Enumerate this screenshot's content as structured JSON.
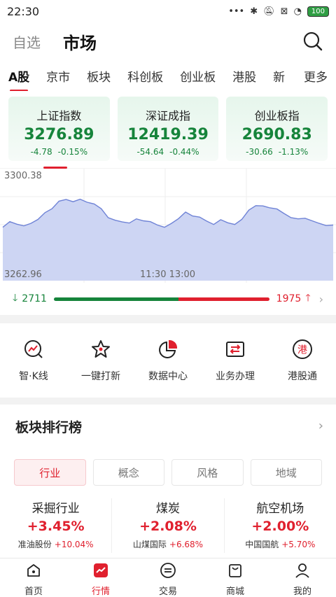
{
  "status": {
    "time": "22:30",
    "battery": "100"
  },
  "header": {
    "watchlist": "自选",
    "market": "市场"
  },
  "tabs": [
    {
      "label": "A股"
    },
    {
      "label": "京市"
    },
    {
      "label": "板块"
    },
    {
      "label": "科创板"
    },
    {
      "label": "创业板"
    },
    {
      "label": "港股"
    },
    {
      "label": "新"
    }
  ],
  "more": "更多",
  "indices": [
    {
      "name": "上证指数",
      "value": "3276.89",
      "change": "-4.78",
      "pct": "-0.15%"
    },
    {
      "name": "深证成指",
      "value": "12419.39",
      "change": "-54.64",
      "pct": "-0.44%"
    },
    {
      "name": "创业板指",
      "value": "2690.83",
      "change": "-30.66",
      "pct": "-1.13%"
    }
  ],
  "intraday": {
    "y_high": "3300.38",
    "y_low": "3262.96",
    "time_label": "11:30 13:00",
    "fill_color": "#cdd5f3",
    "line_color": "#6f83d6"
  },
  "chart_data": {
    "type": "area",
    "ylim": [
      3262.96,
      3300.38
    ],
    "x": [
      0,
      1,
      2,
      3,
      4,
      5,
      6,
      7,
      8,
      9,
      10,
      11,
      12,
      13,
      14,
      15,
      16,
      17,
      18,
      19,
      20,
      21,
      22,
      23,
      24,
      25,
      26,
      27,
      28,
      29,
      30,
      31,
      32,
      33,
      34,
      35,
      36,
      37,
      38,
      39,
      40,
      41,
      42,
      43,
      44,
      45,
      46,
      47
    ],
    "values": [
      3282.0,
      3284.0,
      3283.1,
      3282.5,
      3283.4,
      3284.8,
      3287.2,
      3288.6,
      3291.3,
      3291.9,
      3291.1,
      3292.0,
      3290.9,
      3290.3,
      3288.6,
      3285.4,
      3284.5,
      3283.9,
      3283.5,
      3285.0,
      3284.3,
      3284.0,
      3282.8,
      3282.0,
      3283.4,
      3285.1,
      3287.4,
      3286.0,
      3285.6,
      3284.2,
      3283.0,
      3284.7,
      3283.6,
      3283.0,
      3284.8,
      3288.1,
      3289.7,
      3289.6,
      3288.9,
      3288.5,
      3286.9,
      3285.4,
      3285.0,
      3285.2,
      3284.3,
      3283.4,
      3282.6,
      3282.8
    ]
  },
  "breadth": {
    "down": "2711",
    "up": "1975",
    "down_ratio": 0.58
  },
  "quick": [
    {
      "label": "智·K线",
      "icon": "k-line-icon"
    },
    {
      "label": "一键打新",
      "icon": "star-icon"
    },
    {
      "label": "数据中心",
      "icon": "pie-chart-icon"
    },
    {
      "label": "业务办理",
      "icon": "exchange-icon"
    },
    {
      "label": "港股通",
      "icon": "hk-icon",
      "glyph": "港"
    }
  ],
  "rank": {
    "title": "板块排行榜",
    "segments": [
      {
        "label": "行业"
      },
      {
        "label": "概念"
      },
      {
        "label": "风格"
      },
      {
        "label": "地域"
      }
    ],
    "sectors": [
      {
        "name": "采掘行业",
        "pct": "+3.45%",
        "leader": "准油股份",
        "leader_pct": "+10.04%"
      },
      {
        "name": "煤炭",
        "pct": "+2.08%",
        "leader": "山煤国际",
        "leader_pct": "+6.68%"
      },
      {
        "name": "航空机场",
        "pct": "+2.00%",
        "leader": "中国国航",
        "leader_pct": "+5.70%"
      }
    ]
  },
  "nav": [
    {
      "label": "首页"
    },
    {
      "label": "行情"
    },
    {
      "label": "交易"
    },
    {
      "label": "商城"
    },
    {
      "label": "我的"
    }
  ]
}
